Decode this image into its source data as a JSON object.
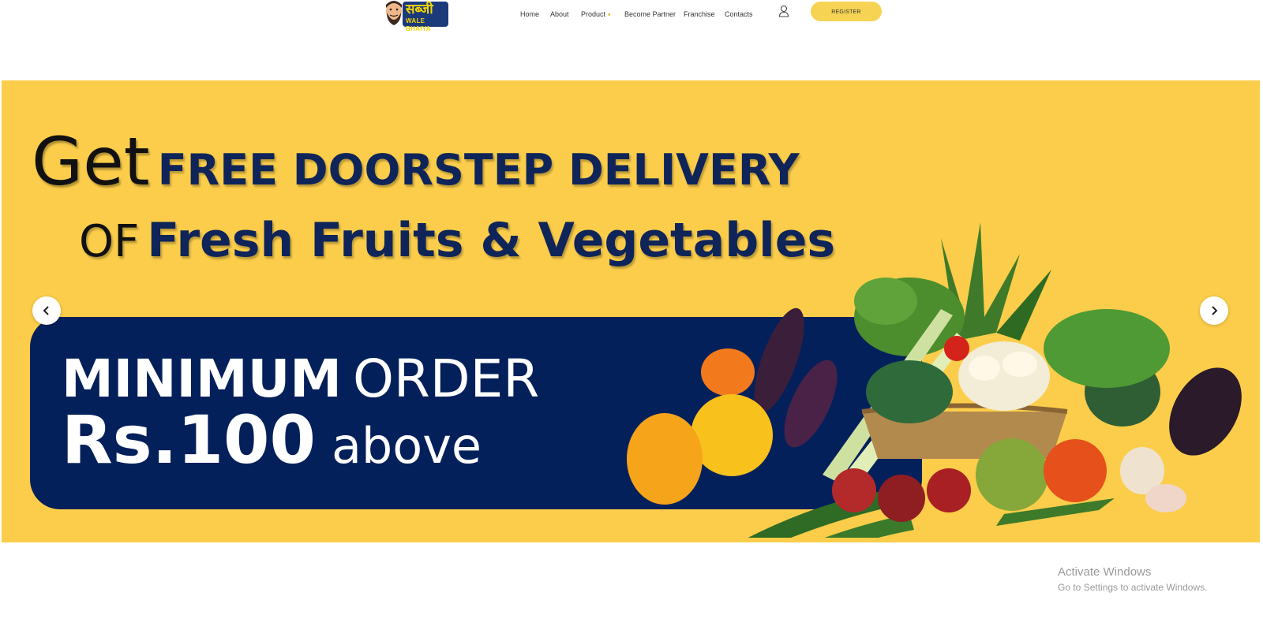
{
  "brand": {
    "logo_text": "सब्जी",
    "logo_subtext": "WALE BHAIYA"
  },
  "nav": {
    "items": [
      {
        "label": "Home"
      },
      {
        "label": "About"
      },
      {
        "label": "Product",
        "has_dropdown": true
      },
      {
        "label": "Become Partner"
      },
      {
        "label": "Franchise"
      },
      {
        "label": "Contacts"
      }
    ],
    "user_icon": "user-icon",
    "register_label": "REGISTER"
  },
  "hero": {
    "line1_prefix": "Get",
    "line1_main": "FREE DOORSTEP DELIVERY",
    "line2_prefix": "OF",
    "line2_main": "Fresh Fruits & Vegetables",
    "min_bold": "MINIMUM",
    "min_light": "ORDER",
    "amount_bold": "Rs.100",
    "amount_light": "above",
    "prev_icon": "chevron-left-icon",
    "next_icon": "chevron-right-icon"
  },
  "watermark": {
    "line1": "Activate Windows",
    "line2": "Go to Settings to activate Windows."
  },
  "colors": {
    "banner_yellow": "#fbcd4a",
    "navy": "#04205b",
    "register_yellow": "#f6d353"
  }
}
